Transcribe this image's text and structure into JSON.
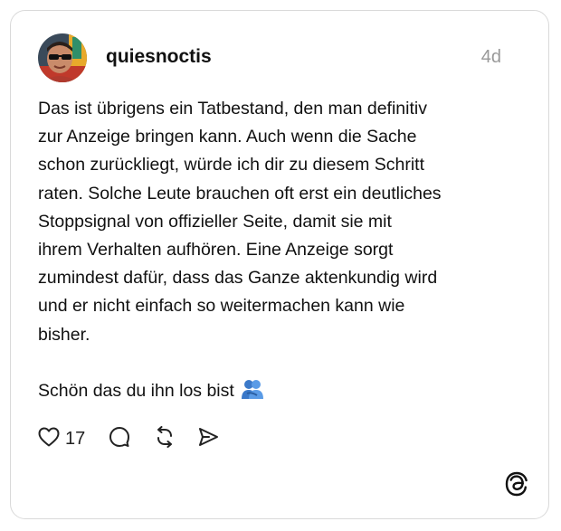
{
  "post": {
    "author": {
      "username": "quiesnoctis",
      "avatar": "avatar-photo"
    },
    "timestamp": "4d",
    "body_lines": [
      "Das ist übrigens ein Tatbestand, den man definitiv",
      "zur Anzeige bringen kann. Auch wenn die Sache",
      "schon zurückliegt, würde ich dir zu diesem Schritt",
      "raten. Solche Leute brauchen oft erst ein deutliches",
      "Stoppsignal von offizieller Seite, damit sie mit",
      "ihrem Verhalten aufhören. Eine Anzeige sorgt",
      "zumindest dafür, dass das Ganze aktenkundig wird",
      "und er nicht einfach so weitermachen kann wie",
      "bisher."
    ],
    "closing_line": "Schön das du ihn los bist",
    "closing_emoji": "people-hugging-emoji",
    "actions": {
      "like_icon": "heart-icon",
      "like_count": "17",
      "reply_icon": "comment-icon",
      "repost_icon": "repost-icon",
      "share_icon": "send-icon"
    }
  },
  "branding": {
    "logo": "threads-logo"
  },
  "colors": {
    "text": "#111111",
    "muted": "#999999",
    "border": "#d9d9d9",
    "background": "#ffffff"
  }
}
